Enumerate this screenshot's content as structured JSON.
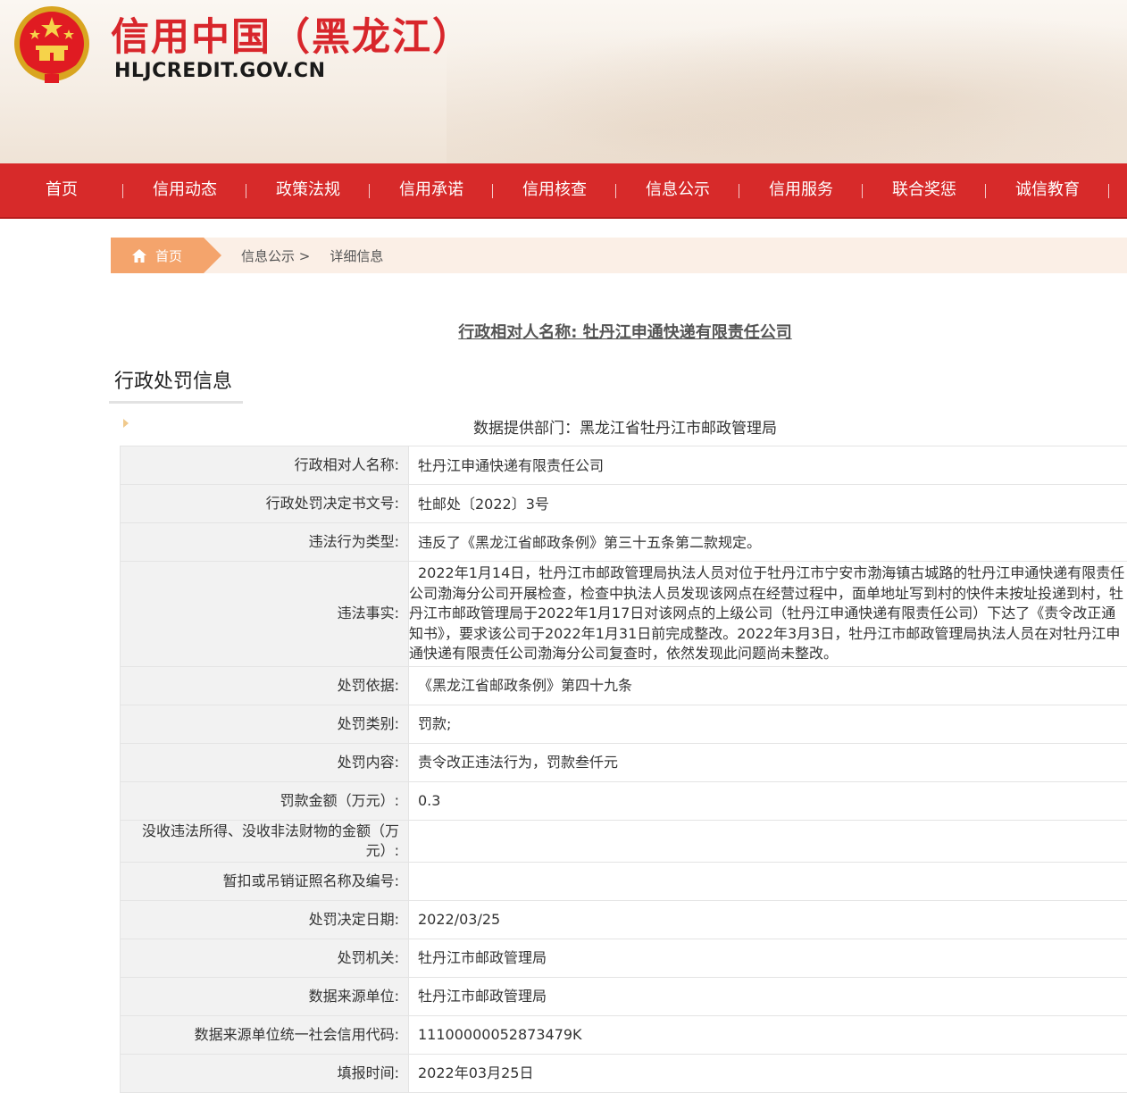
{
  "header": {
    "site_title": "信用中国（黑龙江）",
    "site_domain": "HLJCREDIT.GOV.CN"
  },
  "nav": {
    "items": [
      "首页",
      "信用动态",
      "政策法规",
      "信用承诺",
      "信用核查",
      "信息公示",
      "信用服务",
      "联合奖惩",
      "诚信教育"
    ]
  },
  "breadcrumb": {
    "home": "首页",
    "section": "信息公示 >",
    "current": "详细信息"
  },
  "subject_title": "行政相对人名称: 牡丹江申通快递有限责任公司",
  "section_title": "行政处罚信息",
  "provider": "数据提供部门：黑龙江省牡丹江市邮政管理局",
  "rows": [
    {
      "label": "行政相对人名称:",
      "value": "牡丹江申通快递有限责任公司"
    },
    {
      "label": "行政处罚决定书文号:",
      "value": "牡邮处〔2022〕3号"
    },
    {
      "label": "违法行为类型:",
      "value": "违反了《黑龙江省邮政条例》第三十五条第二款规定。"
    },
    {
      "label": "违法事实:",
      "value": "2022年1月14日，牡丹江市邮政管理局执法人员对位于牡丹江市宁安市渤海镇古城路的牡丹江申通快递有限责任公司渤海分公司开展检查，检查中执法人员发现该网点在经营过程中，面单地址写到村的快件未按址投递到村，牡丹江市邮政管理局于2022年1月17日对该网点的上级公司（牡丹江申通快递有限责任公司）下达了《责令改正通知书》，要求该公司于2022年1月31日前完成整改。2022年3月3日，牡丹江市邮政管理局执法人员在对牡丹江申通快递有限责任公司渤海分公司复查时，依然发现此问题尚未整改。"
    },
    {
      "label": "处罚依据:",
      "value": "《黑龙江省邮政条例》第四十九条"
    },
    {
      "label": "处罚类别:",
      "value": "罚款;"
    },
    {
      "label": "处罚内容:",
      "value": "责令改正违法行为，罚款叁仟元"
    },
    {
      "label": "罚款金额（万元）:",
      "value": "0.3"
    },
    {
      "label": "没收违法所得、没收非法财物的金额（万元）:",
      "value": ""
    },
    {
      "label": "暂扣或吊销证照名称及编号:",
      "value": ""
    },
    {
      "label": "处罚决定日期:",
      "value": "2022/03/25"
    },
    {
      "label": "处罚机关:",
      "value": "牡丹江市邮政管理局"
    },
    {
      "label": "数据来源单位:",
      "value": "牡丹江市邮政管理局"
    },
    {
      "label": "数据来源单位统一社会信用代码:",
      "value": "11100000052873479K"
    },
    {
      "label": "填报时间:",
      "value": "2022年03月25日"
    }
  ],
  "colors": {
    "brand_red": "#d72a2a",
    "title_red": "#d8262b",
    "breadcrumb_home": "#f4a46c",
    "label_bg": "#f2f2f2"
  }
}
